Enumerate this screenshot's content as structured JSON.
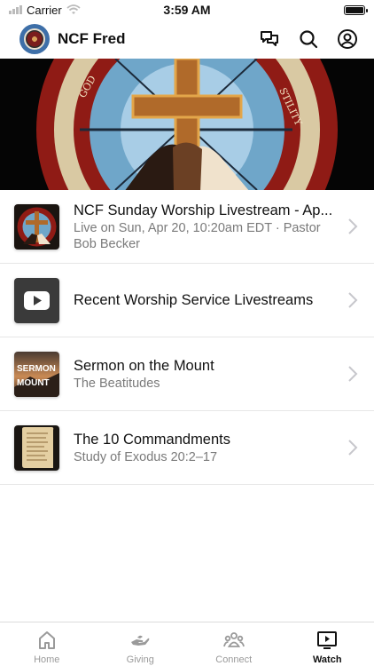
{
  "status_bar": {
    "carrier": "Carrier",
    "time": "3:59 AM"
  },
  "header": {
    "title": "NCF Fred",
    "icons": [
      "chat-icon",
      "search-icon",
      "profile-icon"
    ]
  },
  "hero": {
    "description_icon": "stained-glass-cross"
  },
  "list": [
    {
      "title": "NCF Sunday Worship Livestream - Ap...",
      "subtitle": "Live on Sun, Apr 20, 10:20am EDT · Pastor Bob Becker"
    },
    {
      "title": "Recent Worship Service Livestreams",
      "subtitle": ""
    },
    {
      "title": "Sermon on the Mount",
      "subtitle": "The Beatitudes",
      "thumb_text": {
        "line1": "SERMON",
        "line2": "MOUNT"
      }
    },
    {
      "title": "The 10 Commandments",
      "subtitle": "Study of Exodus 20:2–17"
    }
  ],
  "tabs": [
    {
      "label": "Home",
      "icon": "home-icon",
      "active": false
    },
    {
      "label": "Giving",
      "icon": "giving-icon",
      "active": false
    },
    {
      "label": "Connect",
      "icon": "connect-icon",
      "active": false
    },
    {
      "label": "Watch",
      "icon": "watch-icon",
      "active": true
    }
  ],
  "colors": {
    "accent": "#111111",
    "muted": "#9a9a9a",
    "logo_bg": "#3e6fa8"
  }
}
